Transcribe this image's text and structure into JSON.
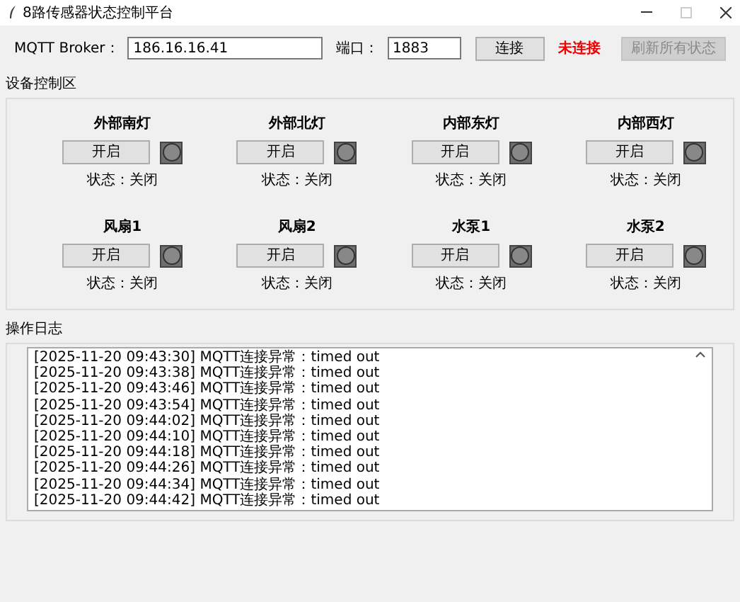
{
  "window": {
    "title": "8路传感器状态控制平台"
  },
  "connection": {
    "broker_label": "MQTT Broker：",
    "broker": "186.16.16.41",
    "port_label": "端口：",
    "port": "1883",
    "connect_button": "连接",
    "status": "未连接",
    "connected": false,
    "refresh_button": {
      "label": "刷新所有状态",
      "disabled": true
    }
  },
  "device_panel": {
    "title": "设备控制区",
    "devices": [
      {
        "name": "外部南灯",
        "button": "开启",
        "on": false,
        "state": "状态：关闭"
      },
      {
        "name": "外部北灯",
        "button": "开启",
        "on": false,
        "state": "状态：关闭"
      },
      {
        "name": "内部东灯",
        "button": "开启",
        "on": false,
        "state": "状态：关闭"
      },
      {
        "name": "内部西灯",
        "button": "开启",
        "on": false,
        "state": "状态：关闭"
      },
      {
        "name": "风扇1",
        "button": "开启",
        "on": false,
        "state": "状态：关闭"
      },
      {
        "name": "风扇2",
        "button": "开启",
        "on": false,
        "state": "状态：关闭"
      },
      {
        "name": "水泵1",
        "button": "开启",
        "on": false,
        "state": "状态：关闭"
      },
      {
        "name": "水泵2",
        "button": "开启",
        "on": false,
        "state": "状态：关闭"
      }
    ]
  },
  "log_panel": {
    "title": "操作日志",
    "lines": [
      "[2025-11-20 09:43:30] MQTT连接异常：timed out",
      "[2025-11-20 09:43:38] MQTT连接异常：timed out",
      "[2025-11-20 09:43:46] MQTT连接异常：timed out",
      "[2025-11-20 09:43:54] MQTT连接异常：timed out",
      "[2025-11-20 09:44:02] MQTT连接异常：timed out",
      "[2025-11-20 09:44:10] MQTT连接异常：timed out",
      "[2025-11-20 09:44:18] MQTT连接异常：timed out",
      "[2025-11-20 09:44:26] MQTT连接异常：timed out",
      "[2025-11-20 09:44:34] MQTT连接异常：timed out",
      "[2025-11-20 09:44:42] MQTT连接异常：timed out"
    ]
  }
}
